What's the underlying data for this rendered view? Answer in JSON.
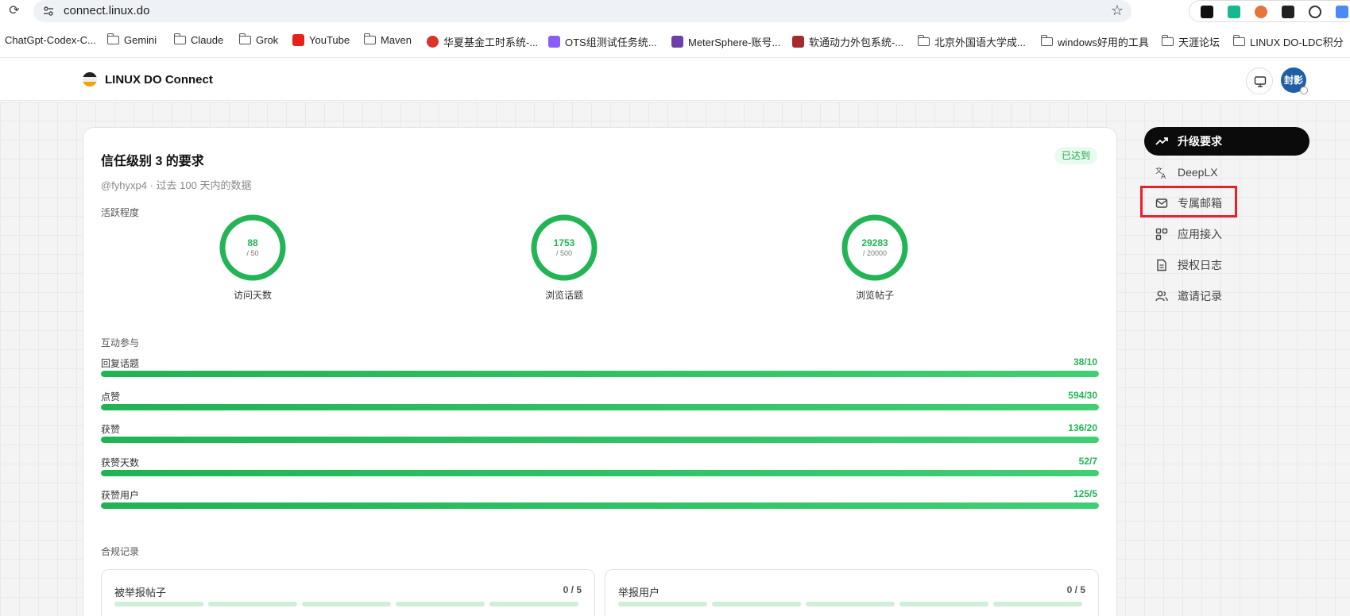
{
  "browser": {
    "url": "connect.linux.do",
    "bookmarks": [
      {
        "label": "ChatGpt-Codex-C...",
        "kind": "none"
      },
      {
        "label": "Gemini",
        "kind": "folder"
      },
      {
        "label": "Claude",
        "kind": "folder"
      },
      {
        "label": "Grok",
        "kind": "folder"
      },
      {
        "label": "YouTube",
        "kind": "youtube"
      },
      {
        "label": "Maven",
        "kind": "folder"
      },
      {
        "label": "华夏基金工时系统-...",
        "kind": "red"
      },
      {
        "label": "OTS组测试任务统...",
        "kind": "purple"
      },
      {
        "label": "MeterSphere-账号...",
        "kind": "violet"
      },
      {
        "label": "软通动力外包系统-...",
        "kind": "darkred"
      },
      {
        "label": "北京外国语大学成...",
        "kind": "folder"
      },
      {
        "label": "windows好用的工具",
        "kind": "folder"
      },
      {
        "label": "天涯论坛",
        "kind": "folder"
      },
      {
        "label": "LINUX DO-LDC积分",
        "kind": "folder"
      }
    ]
  },
  "header": {
    "brand": "LINUX DO Connect",
    "avatar_text": "封影"
  },
  "card": {
    "title": "信任级别 3 的要求",
    "status": "已达到",
    "subtitle": "@fyhyxp4 · 过去 100 天内的数据",
    "section_activity": "活跃程度",
    "section_interaction": "互动参与",
    "section_compliance": "合规记录",
    "rings": [
      {
        "value": "88",
        "max": "/ 50",
        "label": "访问天数",
        "fraction": 1.0
      },
      {
        "value": "1753",
        "max": "/ 500",
        "label": "浏览话题",
        "fraction": 1.0
      },
      {
        "value": "29283",
        "max": "/ 20000",
        "label": "浏览帖子",
        "fraction": 1.0
      }
    ],
    "progress": [
      {
        "label": "回复话题",
        "value": "38/10",
        "fraction": 1.0
      },
      {
        "label": "点赞",
        "value": "594/30",
        "fraction": 1.0
      },
      {
        "label": "获赞",
        "value": "136/20",
        "fraction": 1.0
      },
      {
        "label": "获赞天数",
        "value": "52/7",
        "fraction": 1.0
      },
      {
        "label": "获赞用户",
        "value": "125/5",
        "fraction": 1.0
      }
    ],
    "compliance": [
      {
        "label": "被举报帖子",
        "value": "0 / 5"
      },
      {
        "label": "举报用户",
        "value": "0 / 5"
      }
    ]
  },
  "sidebar": {
    "items": [
      {
        "label": "升级要求",
        "icon": "trending-up-icon",
        "active": true
      },
      {
        "label": "DeepLX",
        "icon": "translate-icon",
        "active": false
      },
      {
        "label": "专属邮箱",
        "icon": "mail-icon",
        "active": false
      },
      {
        "label": "应用接入",
        "icon": "apps-icon",
        "active": false
      },
      {
        "label": "授权日志",
        "icon": "document-icon",
        "active": false
      },
      {
        "label": "邀请记录",
        "icon": "users-icon",
        "active": false
      }
    ]
  },
  "colors": {
    "accent_green": "#22b455",
    "highlight_red": "#e8202a",
    "active_nav": "#0b0b0b"
  }
}
